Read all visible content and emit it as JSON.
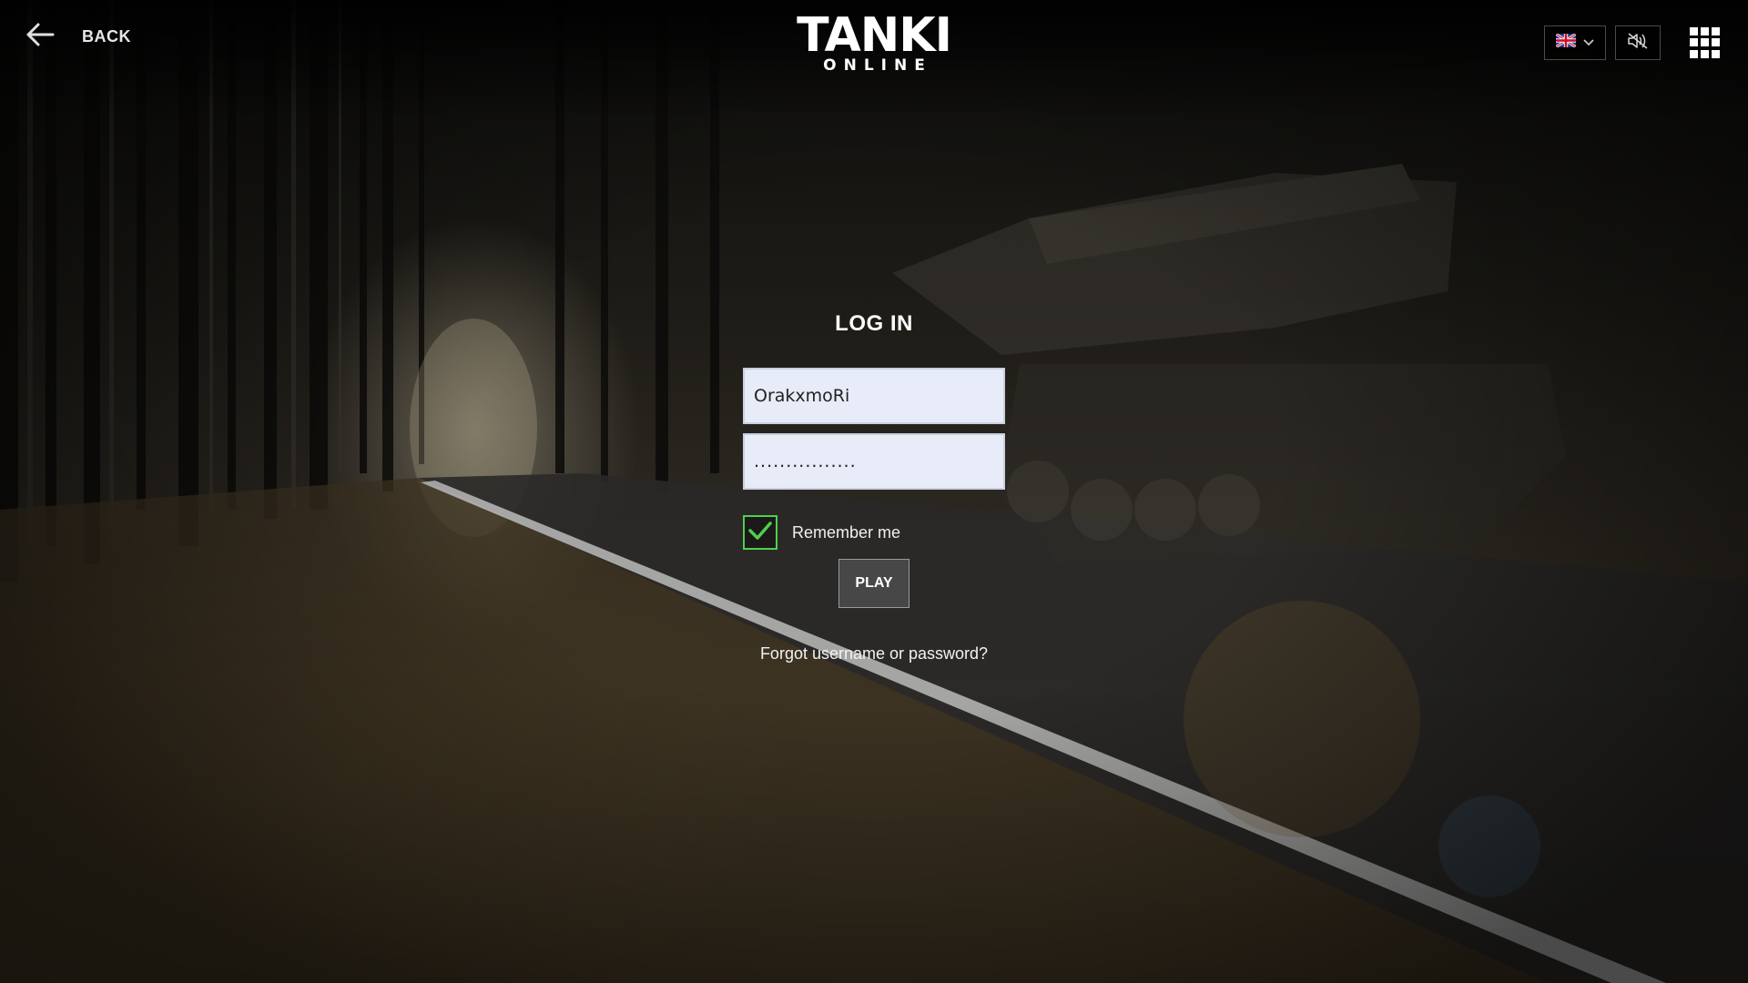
{
  "header": {
    "back_label": "BACK",
    "logo_main": "TANKI",
    "logo_sub": "ONLINE",
    "language_icon": "uk-flag-icon",
    "sound_icon": "sound-muted-icon",
    "menu_icon": "app-grid-icon"
  },
  "login": {
    "title": "LOG IN",
    "username_value": "OrakxmoRi",
    "password_value": "................",
    "remember_label": "Remember me",
    "remember_checked": true,
    "play_label": "PLAY",
    "forgot_label": "Forgot username or password?"
  },
  "colors": {
    "checkbox_accent": "#4fcf4f",
    "field_background": "#e8ecf8",
    "play_button": "#474747"
  }
}
